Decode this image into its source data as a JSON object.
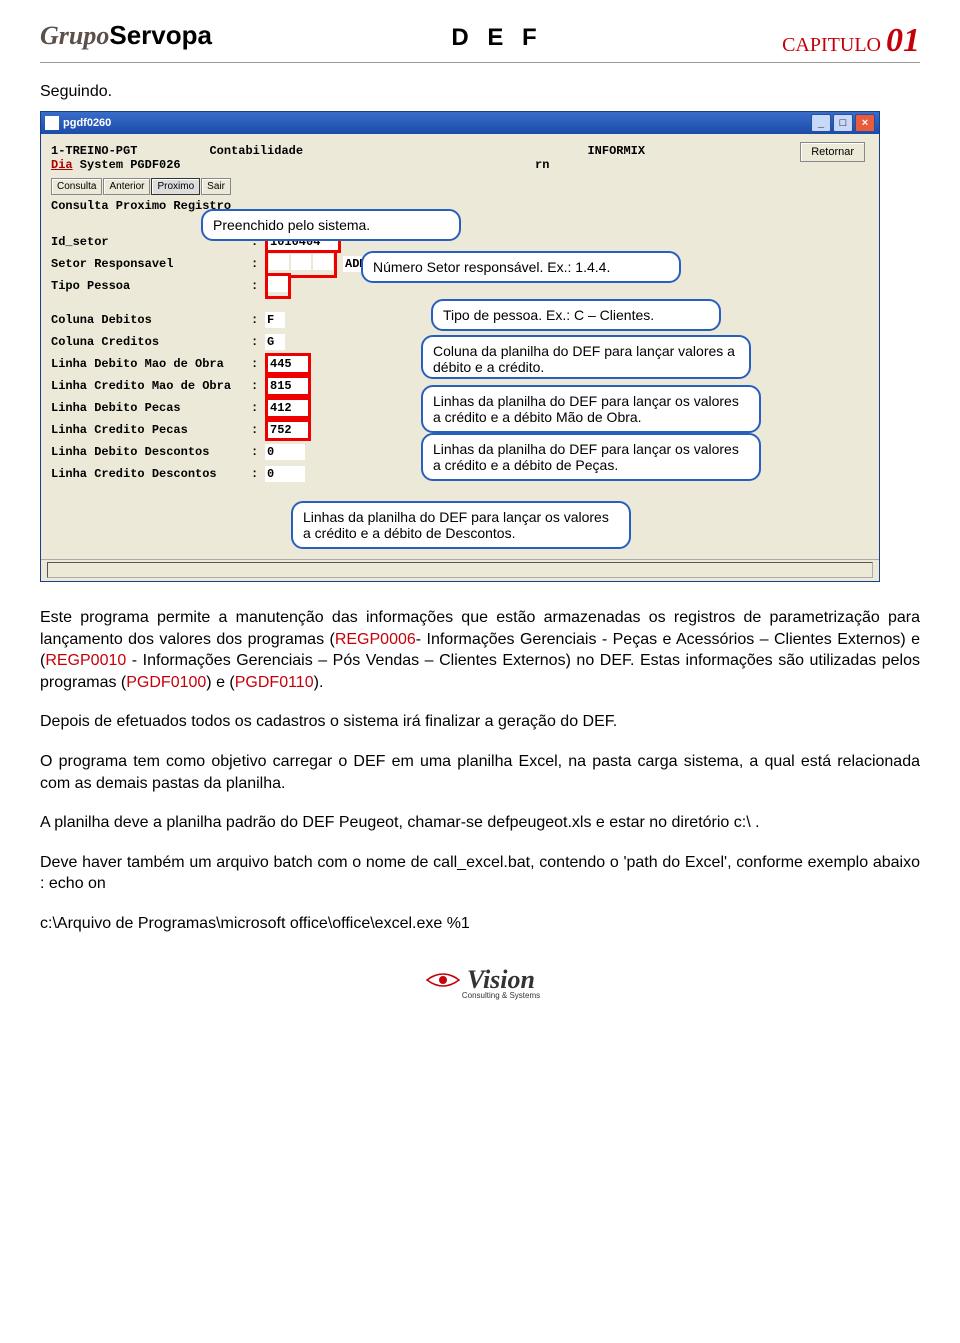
{
  "header": {
    "logo_grupo": "Grupo",
    "logo_servopa": "Servopa",
    "title": "D E F",
    "capitulo_label": "CAPITULO",
    "capitulo_num": "01"
  },
  "intro": "Seguindo.",
  "app": {
    "window_title": "pgdf0260",
    "retornar_btn": "Retornar",
    "line1_left": "1-TREINO-PGT",
    "line1_contab": "Contabilidade",
    "line1_informix": "INFORMIX",
    "line2_dia": "Dia",
    "line2_system": " System  PGDF026",
    "line2_rn": "rn",
    "btns": [
      "Consulta",
      "Anterior",
      "Proximo",
      "Sair"
    ],
    "consulta_line": "Consulta Proximo Registro",
    "fields": {
      "id_setor_label": "Id_setor",
      "id_setor_val": "1010404",
      "setor_resp_label": "Setor Responsavel",
      "setor_resp_val": "ADMINISTRAC. OFICI",
      "tipo_pessoa_label": "Tipo Pessoa",
      "tipo_pessoa_val": "",
      "col_deb_label": "Coluna Debitos",
      "col_deb_val": "F",
      "col_cred_label": "Coluna Creditos",
      "col_cred_val": "G",
      "ldmo_label": "Linha Debito  Mao de Obra ",
      "ldmo_val": "445",
      "lcmo_label": "Linha Credito Mao de Obra ",
      "lcmo_val": "815",
      "ldp_label": "Linha Debito  Pecas",
      "ldp_val": "412",
      "lcp_label": "Linha Credito Pecas",
      "lcp_val": "752",
      "ldd_label": "Linha Debito  Descontos",
      "ldd_val": "0",
      "lcd_label": "Linha Credito Descontos",
      "lcd_val": "0"
    }
  },
  "callouts": {
    "c1": "Preenchido pelo sistema.",
    "c2": "Número Setor responsável. Ex.: 1.4.4.",
    "c3": "Tipo de pessoa. Ex.: C – Clientes.",
    "c4": "Coluna da planilha do DEF para lançar valores a débito e a crédito.",
    "c5": "Linhas da planilha do DEF para lançar os valores a crédito e a débito Mão de Obra.",
    "c6": "Linhas da planilha do DEF para lançar os valores a crédito e a débito de Peças.",
    "c7": "Linhas da planilha do DEF para lançar os valores a crédito e a débito de Descontos."
  },
  "para1_a": "Este programa permite a manutenção das informações que estão armazenadas os registros de parametrização para lançamento dos valores dos programas (",
  "para1_code1": "REGP0006",
  "para1_b": "- Informações Gerenciais - Peças e Acessórios – Clientes Externos) e (",
  "para1_code2": "REGP0010",
  "para1_c": " - Informações Gerenciais – Pós Vendas – Clientes Externos) no DEF. Estas informações são utilizadas pelos programas (",
  "para1_code3": "PGDF0100",
  "para1_d": ") e (",
  "para1_code4": "PGDF0110",
  "para1_e": ").",
  "para2": "Depois de efetuados todos os cadastros o sistema irá finalizar a geração do DEF.",
  "para3": "O programa tem como objetivo carregar o DEF em uma planilha Excel, na pasta carga sistema, a qual está relacionada com as demais pastas da planilha.",
  "para4": "A planilha deve a planilha padrão do DEF Peugeot, chamar-se defpeugeot.xls e estar no diretório c:\\ .",
  "para5": "Deve haver também um arquivo batch com o nome de call_excel.bat, contendo o 'path do Excel', conforme exemplo abaixo : echo on",
  "para6": "c:\\Arquivo de Programas\\microsoft office\\office\\excel.exe %1",
  "footer": {
    "vision": "Vision",
    "sub": "Consulting & Systems"
  }
}
